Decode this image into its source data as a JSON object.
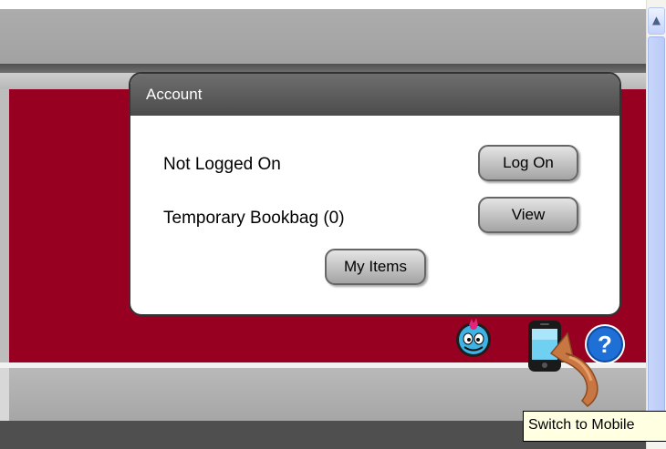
{
  "account_panel": {
    "title": "Account",
    "login_status": "Not Logged On",
    "login_button": "Log On",
    "bookbag_label": "Temporary Bookbag (0)",
    "view_button": "View",
    "my_items_button": "My Items"
  },
  "toolbar": {
    "icons": [
      "mascot-face-icon",
      "mobile-phone-icon",
      "help-icon"
    ]
  },
  "tooltip": {
    "text": "Switch to Mobile"
  },
  "colors": {
    "banner": "#970021",
    "panel_header": "#5a5a5a",
    "help_icon": "#1e6fd6"
  }
}
